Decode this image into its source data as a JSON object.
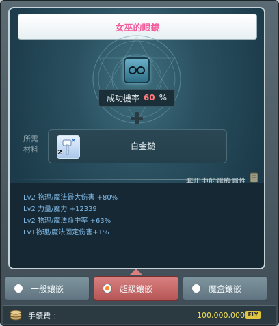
{
  "title": "女巫的眼鏡",
  "success_rate": {
    "label": "成功機率",
    "value": "60",
    "unit": "%"
  },
  "required_material": {
    "label_line1": "所需",
    "label_line2": "材料",
    "count": "2",
    "name": "白金鎚",
    "icon": "hammer-icon"
  },
  "effects": {
    "header": "套用中的鑲嵌屬性",
    "lines": [
      "Lv2 物理/魔法最大伤害 +80%",
      "Lv2 力量/魔力 +12339",
      "Lv2 物理/魔法命中率 +63%",
      "Lv1物理/魔法固定伤害+1%"
    ]
  },
  "tabs": [
    {
      "label": "一般鑲嵌",
      "selected": false
    },
    {
      "label": "超級鑲嵌",
      "selected": true
    },
    {
      "label": "魔盒鑲嵌",
      "selected": false
    }
  ],
  "fee": {
    "label": "手續費 ：",
    "value": "100,000,000",
    "currency": "ELY"
  },
  "colors": {
    "title": "#f35c9c",
    "rate_value": "#ff7a7a",
    "effect_text": "#7fb9e6",
    "active_tab": "#d98080",
    "fee_value": "#f1e15a"
  }
}
